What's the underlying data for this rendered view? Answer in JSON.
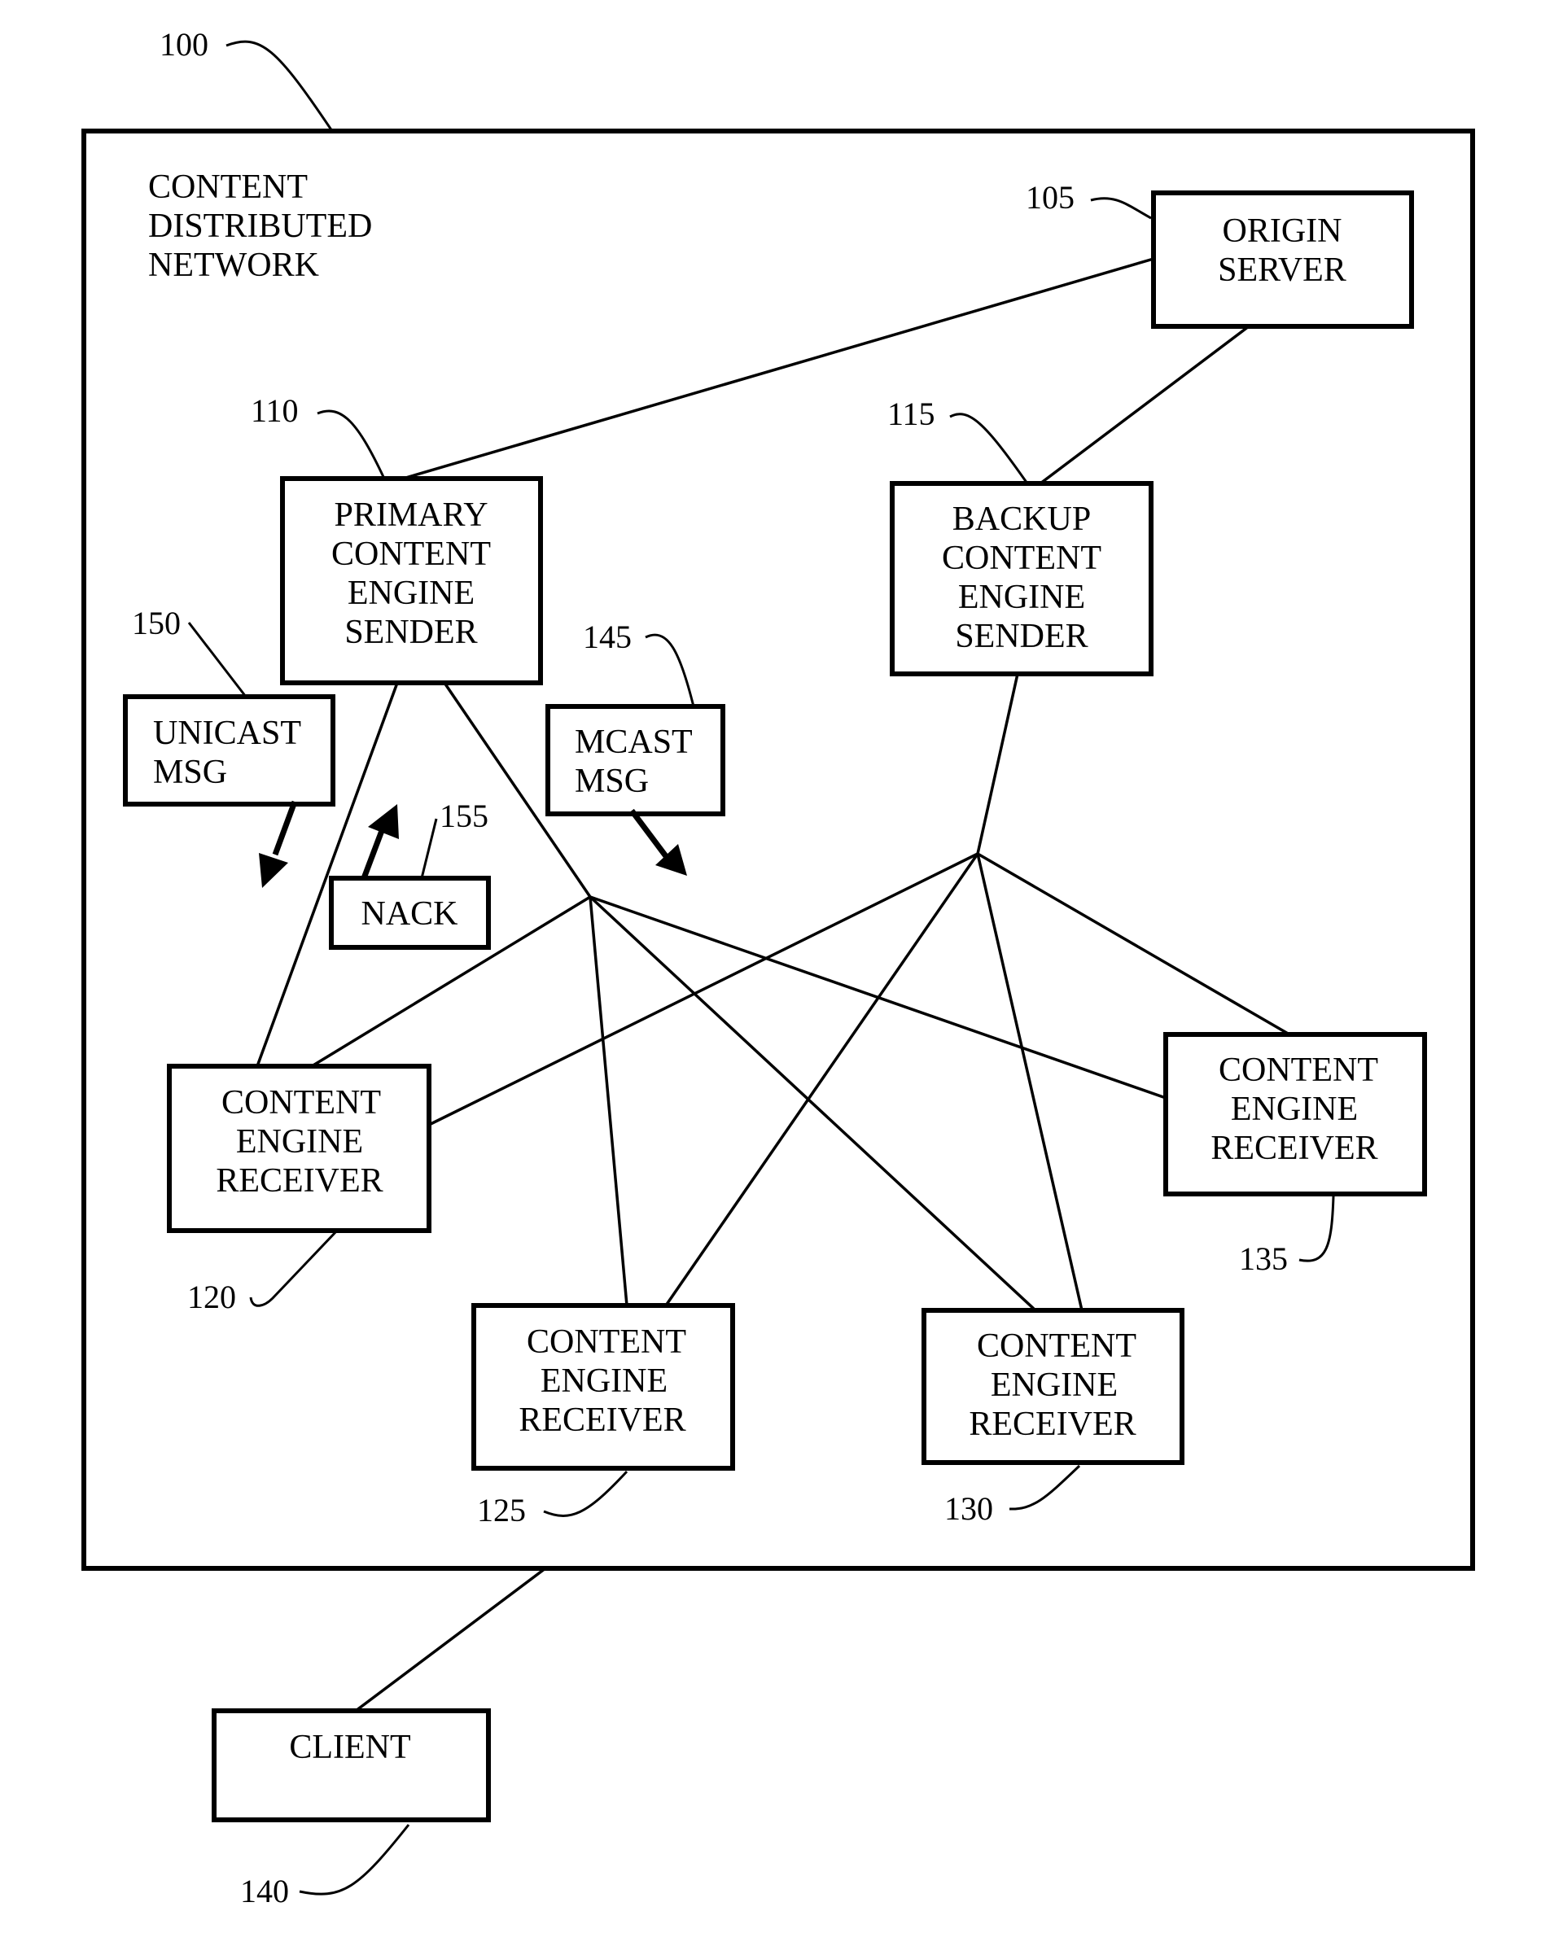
{
  "diagram": {
    "network_label": [
      "CONTENT",
      "DISTRIBUTED",
      "NETWORK"
    ],
    "network_ref": "100",
    "nodes": {
      "origin_server": {
        "ref": "105",
        "lines": [
          "ORIGIN",
          "SERVER"
        ]
      },
      "primary_sender": {
        "ref": "110",
        "lines": [
          "PRIMARY",
          "CONTENT",
          "ENGINE",
          "SENDER"
        ]
      },
      "backup_sender": {
        "ref": "115",
        "lines": [
          "BACKUP",
          "CONTENT",
          "ENGINE",
          "SENDER"
        ]
      },
      "receiver_120": {
        "ref": "120",
        "lines": [
          "CONTENT",
          "ENGINE",
          "RECEIVER"
        ]
      },
      "receiver_125": {
        "ref": "125",
        "lines": [
          "CONTENT",
          "ENGINE",
          "RECEIVER"
        ]
      },
      "receiver_130": {
        "ref": "130",
        "lines": [
          "CONTENT",
          "ENGINE",
          "RECEIVER"
        ]
      },
      "receiver_135": {
        "ref": "135",
        "lines": [
          "CONTENT",
          "ENGINE",
          "RECEIVER"
        ]
      },
      "client": {
        "ref": "140",
        "lines": [
          "CLIENT"
        ]
      }
    },
    "messages": {
      "mcast_msg": {
        "ref": "145",
        "lines": [
          "MCAST",
          "MSG"
        ]
      },
      "unicast_msg": {
        "ref": "150",
        "lines": [
          "UNICAST",
          "MSG"
        ]
      },
      "nack": {
        "ref": "155",
        "lines": [
          "NACK"
        ]
      }
    },
    "connections": [
      [
        "origin_server",
        "primary_sender"
      ],
      [
        "origin_server",
        "backup_sender"
      ],
      [
        "primary_sender",
        "receiver_120"
      ],
      [
        "primary_sender",
        "multicast_hub_primary"
      ],
      [
        "multicast_hub_primary",
        "receiver_120"
      ],
      [
        "multicast_hub_primary",
        "receiver_125"
      ],
      [
        "multicast_hub_primary",
        "receiver_130"
      ],
      [
        "multicast_hub_primary",
        "receiver_135"
      ],
      [
        "backup_sender",
        "multicast_hub_backup"
      ],
      [
        "multicast_hub_backup",
        "receiver_120"
      ],
      [
        "multicast_hub_backup",
        "receiver_125"
      ],
      [
        "multicast_hub_backup",
        "receiver_130"
      ],
      [
        "multicast_hub_backup",
        "receiver_135"
      ],
      [
        "network",
        "client"
      ]
    ]
  }
}
